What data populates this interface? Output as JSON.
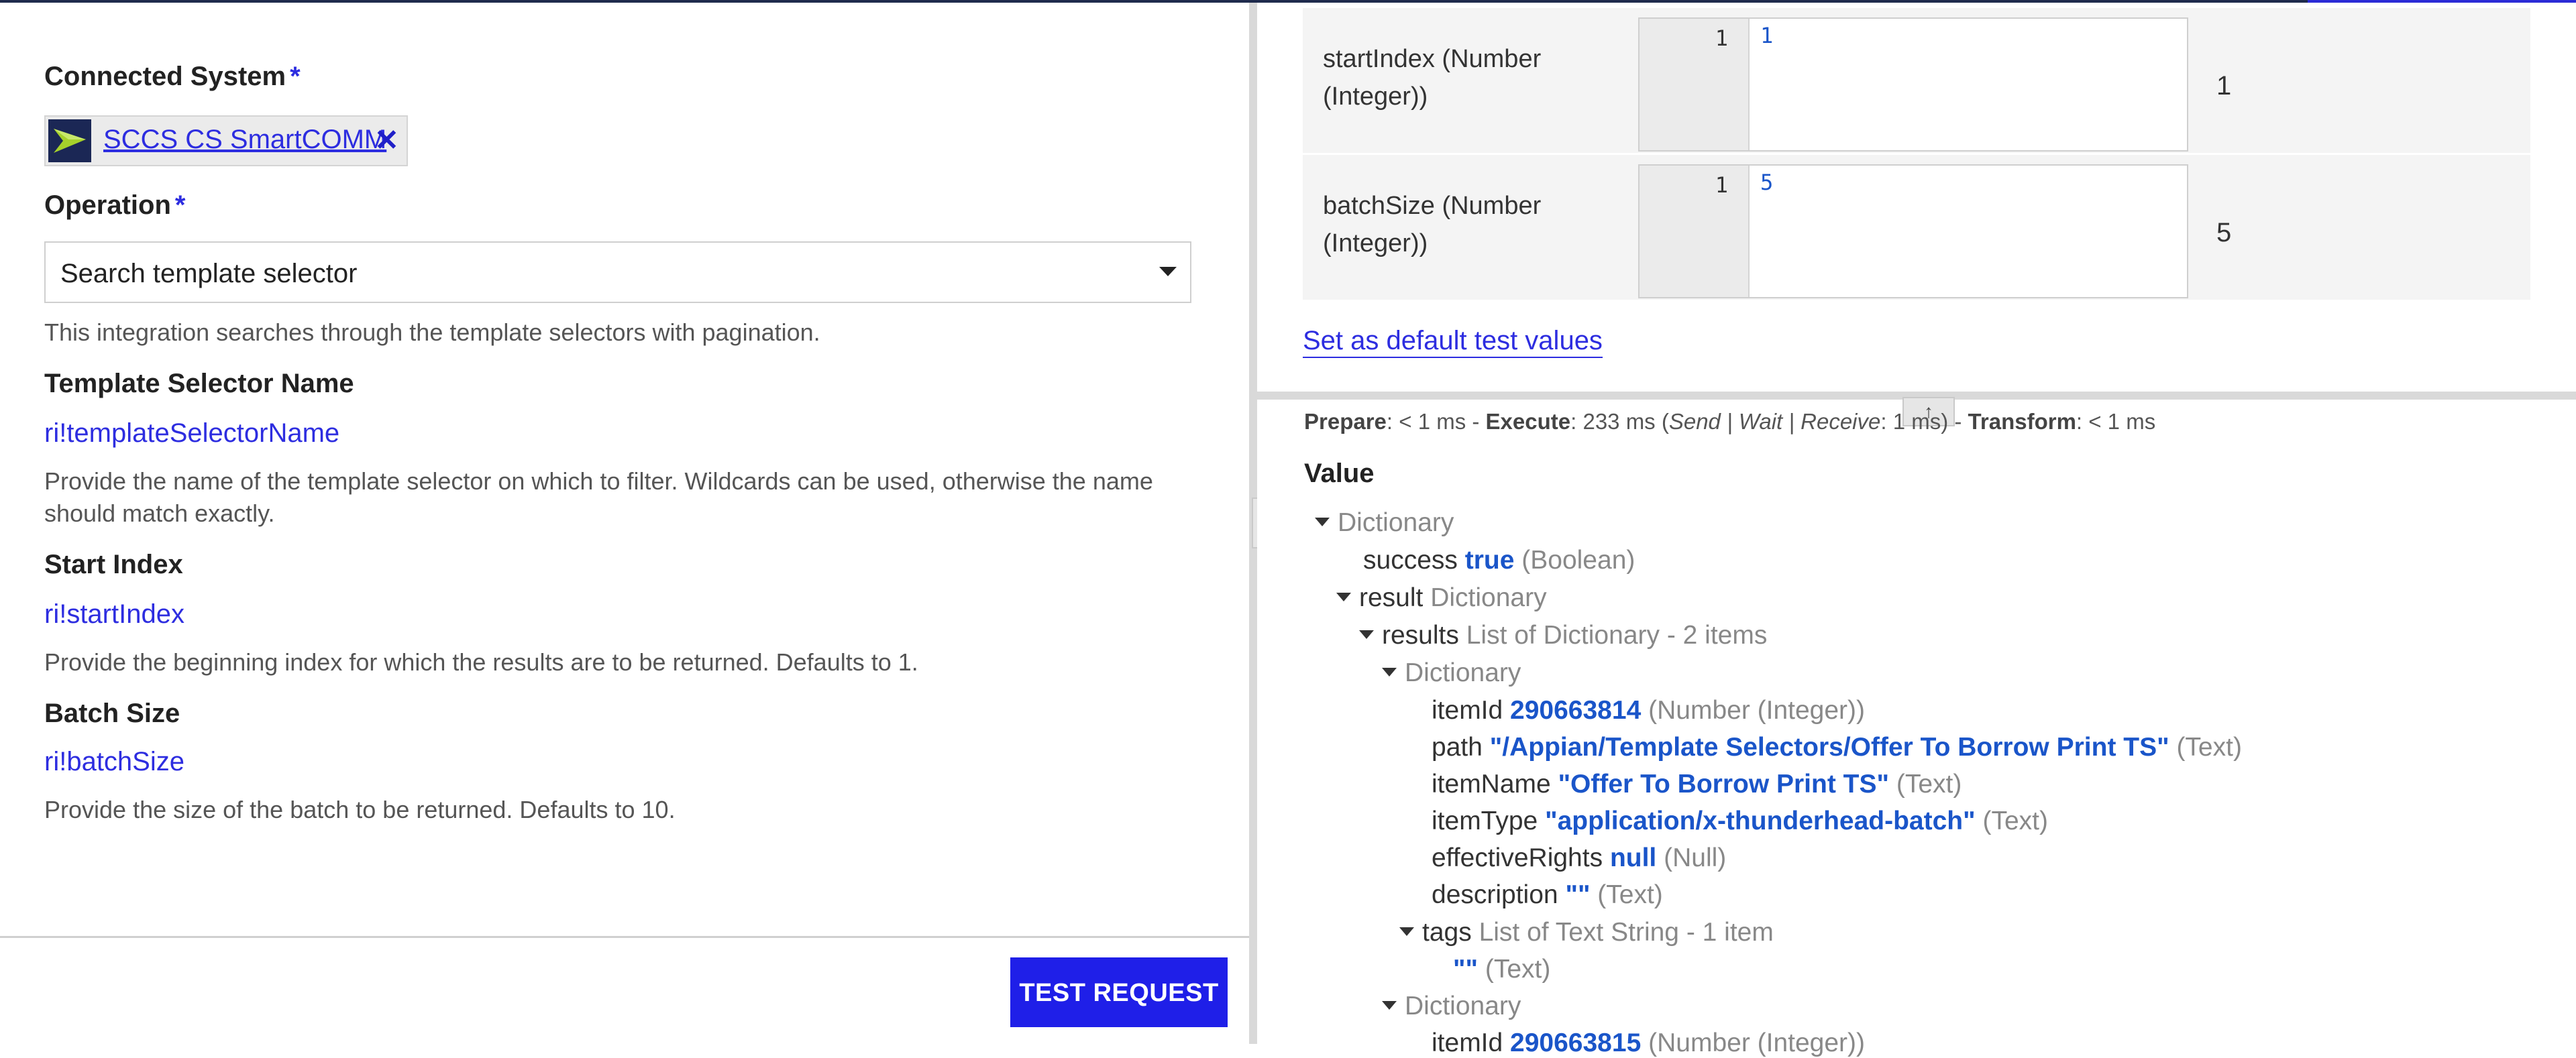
{
  "left": {
    "connected_system_label": "Connected System",
    "required_mark": "*",
    "connected_system_value": "SCCS CS SmartCOMM",
    "operation_label": "Operation",
    "operation_value": "Search template selector",
    "operation_desc": "This integration searches through the template selectors with pagination.",
    "params": [
      {
        "label": "Template Selector Name",
        "ref": "ri!templateSelectorName",
        "desc": "Provide the name of the template selector on which to filter. Wildcards can be used, otherwise the name should match exactly."
      },
      {
        "label": "Start Index",
        "ref": "ri!startIndex",
        "desc": "Provide the beginning index for which the results are to be returned. Defaults to 1."
      },
      {
        "label": "Batch Size",
        "ref": "ri!batchSize",
        "desc": "Provide the size of the batch to be returned. Defaults to 10."
      }
    ],
    "test_button": "TEST REQUEST"
  },
  "right": {
    "inputs": [
      {
        "name": "startIndex (Number (Integer))",
        "line": "1",
        "code": "1",
        "result": "1"
      },
      {
        "name": "batchSize (Number (Integer))",
        "line": "1",
        "code": "5",
        "result": "5"
      }
    ],
    "default_link": "Set as default test values",
    "timing": {
      "prepare_label": "Prepare",
      "prepare_val": ": < 1 ms - ",
      "execute_label": "Execute",
      "execute_val": ": 233 ms (",
      "phases": "Send | Wait | Receive",
      "phases_val": ": 1 ms) - ",
      "transform_label": "Transform",
      "transform_val": ": < 1 ms"
    },
    "value_heading": "Value",
    "tree": {
      "root": "Dictionary",
      "success_key": "success",
      "success_val": "true",
      "success_type": "(Boolean)",
      "result_key": "result",
      "result_type": "Dictionary",
      "results_key": "results",
      "results_type": "List of Dictionary - 2 items",
      "dict1": "Dictionary",
      "itemId_key": "itemId",
      "itemId_val": "290663814",
      "itemId_type": "(Number (Integer))",
      "path_key": "path",
      "path_val": "\"/Appian/Template Selectors/Offer To Borrow Print TS\"",
      "path_type": "(Text)",
      "itemName_key": "itemName",
      "itemName_val": "\"Offer To Borrow Print TS\"",
      "itemName_type": "(Text)",
      "itemType_key": "itemType",
      "itemType_val": "\"application/x-thunderhead-batch\"",
      "itemType_type": "(Text)",
      "rights_key": "effectiveRights",
      "rights_val": "null",
      "rights_type": "(Null)",
      "desc_key": "description",
      "desc_val": "\"\"",
      "desc_type": "(Text)",
      "tags_key": "tags",
      "tags_type": "List of Text String - 1 item",
      "tag0_val": "\"\"",
      "tag0_type": "(Text)",
      "dict2": "Dictionary",
      "itemId2_key": "itemId",
      "itemId2_val": "290663815",
      "itemId2_type": "(Number (Integer))"
    }
  }
}
